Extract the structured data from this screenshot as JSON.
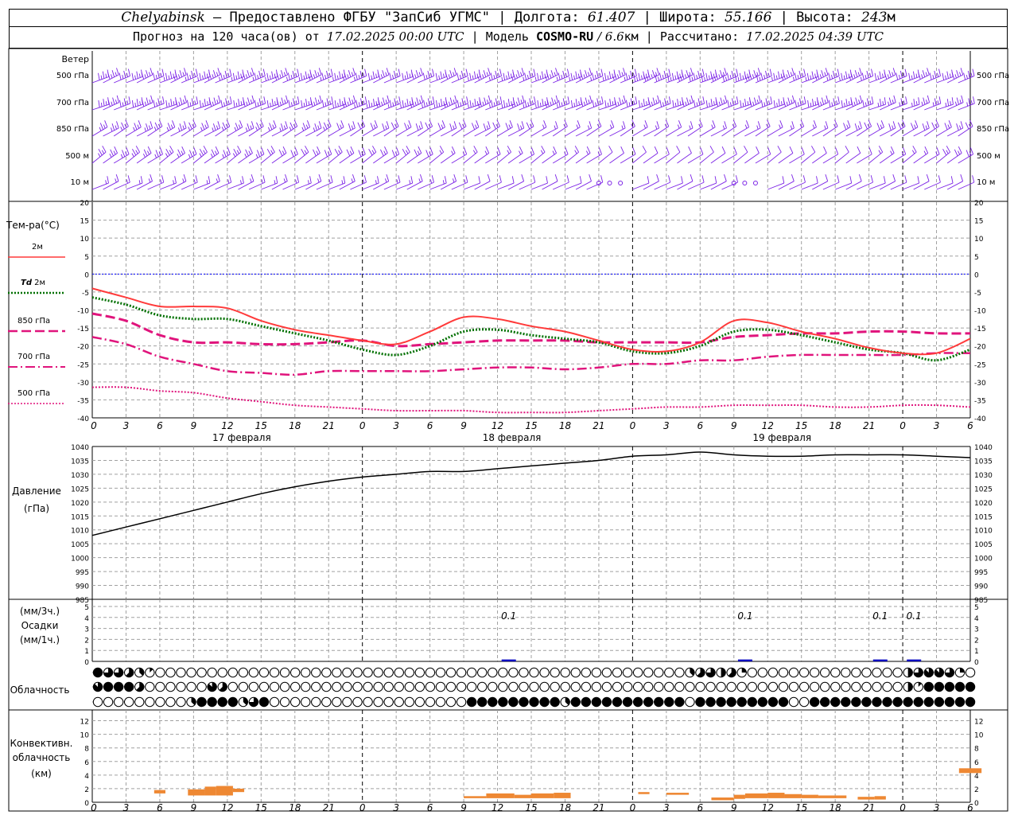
{
  "header": {
    "city": "Chelyabinsk",
    "dash": " — ",
    "provider": "Предоставлено ФГБУ \"ЗапСиб УГМС\"",
    "sep": " | ",
    "lon_label": "Долгота: ",
    "lon": "61.407",
    "lat_label": "Широта: ",
    "lat": "55.166",
    "alt_label": "Высота: ",
    "alt": "243",
    "alt_unit": "м",
    "forecast_label": "Прогноз на 120 часа(ов) от ",
    "forecast_start": "17.02.2025 00:00 UTC",
    "model_label": "Модель ",
    "model": "COSMO-RU",
    "model_res": " / 6.6",
    "model_res_unit": "км",
    "calc_label": "Рассчитано: ",
    "calc_time": "17.02.2025 04:39 UTC"
  },
  "colors": {
    "grid": "#a0a0a0",
    "wind": "#7b22e6",
    "t2m": "#ff3a3a",
    "td2m": "#007000",
    "t850": "#e0147c",
    "t700": "#e0147c",
    "t500": "#e0147c",
    "zero": "#0000ff",
    "pressure": "#000000",
    "precip": "#0000c0",
    "convective": "#ee8833"
  },
  "wind": {
    "title": "Ветер",
    "levels": [
      "500 гПа",
      "700 гПа",
      "850 гПа",
      "500 м",
      "10 м"
    ]
  },
  "temp_legend": {
    "title": "Тем-ра(°C)",
    "t2m": "2м",
    "td_prefix": "Td",
    "td_suffix": " 2м",
    "t850": "850 гПа",
    "t700": "700 гПа",
    "t500": "500 гПа"
  },
  "pressure_labels": [
    "Давление",
    "(гПа)"
  ],
  "precip_labels": [
    "(мм/3ч.)",
    "Осадки",
    "(мм/1ч.)"
  ],
  "cloud_label": "Облачность",
  "conv_labels": [
    "Конвективн.",
    "облачность",
    "(км)"
  ],
  "time_ticks": [
    "0",
    "3",
    "6",
    "9",
    "12",
    "15",
    "18",
    "21",
    "0",
    "3",
    "6",
    "9",
    "12",
    "15",
    "18",
    "21",
    "0",
    "3",
    "6",
    "9",
    "12",
    "15",
    "18",
    "21",
    "0",
    "3",
    "6"
  ],
  "dates": [
    {
      "hour": 12,
      "label": "17 февраля"
    },
    {
      "hour": 36,
      "label": "18 февраля"
    },
    {
      "hour": 60,
      "label": "19 февраля"
    }
  ],
  "chart_data": [
    {
      "type": "line",
      "title": "Тем-ра(°C)",
      "x_unit": "hours from 17.02.2025 00:00 UTC",
      "xlim": [
        0,
        78
      ],
      "ylim": [
        -40,
        20
      ],
      "yticks": [
        20,
        15,
        10,
        5,
        0,
        -5,
        -10,
        -15,
        -20,
        -25,
        -30,
        -35,
        -40
      ],
      "x": [
        0,
        3,
        6,
        9,
        12,
        15,
        18,
        21,
        24,
        27,
        30,
        33,
        36,
        39,
        42,
        45,
        48,
        51,
        54,
        57,
        60,
        63,
        66,
        69,
        72,
        75,
        78
      ],
      "series": [
        {
          "name": "2м",
          "values": [
            -4,
            -6.5,
            -9,
            -9,
            -9.5,
            -13,
            -15.5,
            -17,
            -18.5,
            -19.5,
            -16,
            -12,
            -12.5,
            -14.5,
            -16,
            -18.5,
            -21,
            -21.5,
            -19,
            -13,
            -13.5,
            -16,
            -18,
            -20.5,
            -22,
            -22,
            -18
          ]
        },
        {
          "name": "Td 2м",
          "values": [
            -6.5,
            -8.5,
            -11.5,
            -12.5,
            -12.5,
            -14.5,
            -16.5,
            -18.5,
            -21,
            -22.5,
            -20,
            -16,
            -15.5,
            -17,
            -18,
            -19,
            -21.5,
            -22,
            -20,
            -16,
            -15.5,
            -17,
            -19,
            -21,
            -22,
            -24,
            -21
          ]
        },
        {
          "name": "850 гПа",
          "values": [
            -11,
            -13,
            -17,
            -19,
            -19,
            -19.5,
            -19.5,
            -19,
            -18.5,
            -20,
            -19.5,
            -19,
            -18.5,
            -18.5,
            -18.5,
            -19,
            -19,
            -19,
            -19,
            -17.5,
            -17,
            -16.5,
            -16.5,
            -16,
            -16,
            -16.5,
            -16.5
          ]
        },
        {
          "name": "700 гПа",
          "values": [
            -17.5,
            -19.5,
            -23,
            -25,
            -27,
            -27.5,
            -28,
            -27,
            -27,
            -27,
            -27,
            -26.5,
            -26,
            -26,
            -26.5,
            -26,
            -25,
            -25,
            -24,
            -24,
            -23,
            -22.5,
            -22.5,
            -22.5,
            -22.5,
            -22,
            -22
          ]
        },
        {
          "name": "500 гПа",
          "values": [
            -31.5,
            -31.5,
            -32.5,
            -33,
            -34.5,
            -35.5,
            -36.5,
            -37,
            -37.5,
            -38,
            -38,
            -38,
            -38.5,
            -38.5,
            -38.5,
            -38,
            -37.5,
            -37,
            -37,
            -36.5,
            -36.5,
            -36.5,
            -37,
            -37,
            -36.5,
            -36.5,
            -37
          ]
        }
      ]
    },
    {
      "type": "line",
      "title": "Давление",
      "ylabel": "(гПа)",
      "xlim": [
        0,
        78
      ],
      "ylim": [
        985,
        1040
      ],
      "yticks": [
        1040,
        1035,
        1030,
        1025,
        1020,
        1015,
        1010,
        1005,
        1000,
        995,
        990,
        985
      ],
      "x": [
        0,
        3,
        6,
        9,
        12,
        15,
        18,
        21,
        24,
        27,
        30,
        33,
        36,
        39,
        42,
        45,
        48,
        51,
        54,
        57,
        60,
        63,
        66,
        69,
        72,
        75,
        78
      ],
      "series": [
        {
          "name": "Давление",
          "values": [
            1008,
            1011,
            1014,
            1017,
            1020,
            1023,
            1025.5,
            1027.5,
            1029,
            1030,
            1031,
            1031,
            1032,
            1033,
            1034,
            1035,
            1036.5,
            1037,
            1038,
            1037,
            1036.5,
            1036.5,
            1037,
            1037,
            1037,
            1036.5,
            1036
          ]
        }
      ]
    },
    {
      "type": "bar",
      "title": "Осадки",
      "ylim": [
        0,
        5
      ],
      "yticks": [
        5,
        4,
        3,
        2,
        1,
        0
      ],
      "bars": [
        {
          "x": 37,
          "value": 0.1,
          "label": "0.1"
        },
        {
          "x": 58,
          "value": 0.1,
          "label": "0.1"
        },
        {
          "x": 70,
          "value": 0.1,
          "label": "0.1"
        },
        {
          "x": 73,
          "value": 0.1,
          "label": "0.1"
        }
      ]
    },
    {
      "type": "bar",
      "title": "Конвективн. облачность",
      "ylabel": "(км)",
      "ylim": [
        0,
        13
      ],
      "yticks": [
        12,
        10,
        8,
        6,
        4,
        2,
        0
      ],
      "bars": [
        {
          "x0": 5.5,
          "x1": 6.5,
          "lo": 1.3,
          "hi": 1.8
        },
        {
          "x0": 8.5,
          "x1": 10,
          "lo": 1.0,
          "hi": 1.9
        },
        {
          "x0": 10,
          "x1": 11,
          "lo": 1.0,
          "hi": 2.3
        },
        {
          "x0": 11,
          "x1": 12.5,
          "lo": 1.0,
          "hi": 2.4
        },
        {
          "x0": 12.5,
          "x1": 13.5,
          "lo": 1.5,
          "hi": 2.0
        },
        {
          "x0": 33,
          "x1": 35,
          "lo": 0.6,
          "hi": 0.9
        },
        {
          "x0": 35,
          "x1": 37.5,
          "lo": 0.6,
          "hi": 1.3
        },
        {
          "x0": 37.5,
          "x1": 39,
          "lo": 0.6,
          "hi": 1.1
        },
        {
          "x0": 39,
          "x1": 41,
          "lo": 0.6,
          "hi": 1.3
        },
        {
          "x0": 41,
          "x1": 42.5,
          "lo": 0.6,
          "hi": 1.4
        },
        {
          "x0": 48.5,
          "x1": 49.5,
          "lo": 1.2,
          "hi": 1.5
        },
        {
          "x0": 51,
          "x1": 53,
          "lo": 1.1,
          "hi": 1.4
        },
        {
          "x0": 55,
          "x1": 57,
          "lo": 0.3,
          "hi": 0.7
        },
        {
          "x0": 57,
          "x1": 58,
          "lo": 0.5,
          "hi": 1.1
        },
        {
          "x0": 58,
          "x1": 60,
          "lo": 0.6,
          "hi": 1.3
        },
        {
          "x0": 60,
          "x1": 61.5,
          "lo": 0.6,
          "hi": 1.4
        },
        {
          "x0": 61.5,
          "x1": 63,
          "lo": 0.6,
          "hi": 1.2
        },
        {
          "x0": 63,
          "x1": 64.5,
          "lo": 0.6,
          "hi": 1.1
        },
        {
          "x0": 64.5,
          "x1": 67,
          "lo": 0.6,
          "hi": 1.0
        },
        {
          "x0": 68,
          "x1": 69.5,
          "lo": 0.4,
          "hi": 0.8
        },
        {
          "x0": 69.5,
          "x1": 70.5,
          "lo": 0.4,
          "hi": 0.9
        },
        {
          "x0": 77,
          "x1": 79,
          "lo": 4.3,
          "hi": 5.0
        }
      ]
    }
  ],
  "cloud_cover": {
    "rows": [
      [
        8,
        6,
        6,
        5,
        3,
        1,
        0,
        0,
        0,
        0,
        0,
        0,
        0,
        0,
        0,
        0,
        0,
        0,
        0,
        0,
        0,
        0,
        0,
        0,
        0,
        0,
        0,
        0,
        0,
        0,
        0,
        0,
        0,
        0,
        0,
        0,
        0,
        0,
        0,
        0,
        0,
        0,
        0,
        0,
        0,
        0,
        0,
        0,
        0,
        0,
        0,
        0,
        0,
        0,
        0,
        0,
        0,
        3,
        5,
        6,
        4,
        5,
        2,
        0,
        0,
        0,
        0,
        0,
        0,
        0,
        0,
        0,
        0,
        0,
        0,
        0,
        0,
        0,
        4,
        6,
        7,
        7,
        6,
        2,
        0
      ],
      [
        7,
        8,
        8,
        8,
        5,
        0,
        0,
        0,
        0,
        0,
        0,
        7,
        5,
        0,
        0,
        0,
        0,
        0,
        0,
        0,
        0,
        0,
        0,
        0,
        0,
        0,
        0,
        0,
        0,
        0,
        0,
        0,
        0,
        0,
        0,
        0,
        0,
        0,
        0,
        0,
        0,
        0,
        0,
        0,
        0,
        0,
        0,
        0,
        0,
        0,
        0,
        0,
        0,
        0,
        0,
        0,
        0,
        0,
        0,
        0,
        0,
        0,
        0,
        0,
        0,
        0,
        0,
        0,
        0,
        0,
        0,
        0,
        0,
        0,
        0,
        0,
        0,
        0,
        4,
        1,
        8,
        8,
        8,
        8,
        8
      ],
      [
        0,
        0,
        0,
        0,
        0,
        0,
        0,
        0,
        0,
        3,
        8,
        8,
        8,
        8,
        3,
        6,
        8,
        0,
        0,
        0,
        0,
        0,
        0,
        0,
        0,
        0,
        0,
        0,
        0,
        0,
        0,
        0,
        0,
        0,
        0,
        0,
        8,
        8,
        8,
        8,
        8,
        8,
        8,
        8,
        8,
        3,
        8,
        8,
        8,
        8,
        8,
        8,
        8,
        8,
        8,
        8,
        8,
        0,
        8,
        8,
        8,
        8,
        8,
        8,
        8,
        8,
        8,
        0,
        0,
        8,
        8,
        8,
        8,
        8,
        8,
        8,
        8,
        8,
        8,
        8,
        8,
        8,
        8,
        8,
        8
      ]
    ]
  },
  "wind_barbs": {
    "rows": [
      {
        "dir": 20,
        "speed": [
          25,
          25,
          30,
          30,
          30,
          30,
          30,
          30,
          25,
          25,
          25,
          30,
          30,
          30,
          30,
          30,
          35,
          35,
          35,
          35,
          30,
          30,
          30,
          25,
          25,
          25,
          25
        ]
      },
      {
        "dir": 15,
        "speed": [
          25,
          25,
          25,
          25,
          25,
          25,
          25,
          30,
          30,
          30,
          30,
          30,
          30,
          30,
          25,
          25,
          25,
          25,
          25,
          25,
          25,
          25,
          25,
          20,
          20,
          20,
          20
        ]
      },
      {
        "dir": 25,
        "speed": [
          20,
          20,
          20,
          20,
          20,
          20,
          20,
          15,
          15,
          15,
          15,
          15,
          15,
          10,
          10,
          10,
          10,
          10,
          10,
          10,
          10,
          10,
          15,
          15,
          15,
          15,
          15
        ]
      },
      {
        "dir": 30,
        "speed": [
          20,
          20,
          20,
          20,
          20,
          15,
          15,
          15,
          15,
          15,
          10,
          10,
          10,
          10,
          10,
          5,
          5,
          5,
          5,
          5,
          5,
          5,
          5,
          10,
          10,
          15,
          15
        ]
      },
      {
        "dir": 20,
        "speed": [
          10,
          10,
          10,
          10,
          10,
          10,
          10,
          10,
          10,
          10,
          10,
          5,
          5,
          5,
          5,
          0,
          5,
          5,
          5,
          0,
          5,
          5,
          5,
          5,
          5,
          5,
          5
        ]
      }
    ]
  }
}
